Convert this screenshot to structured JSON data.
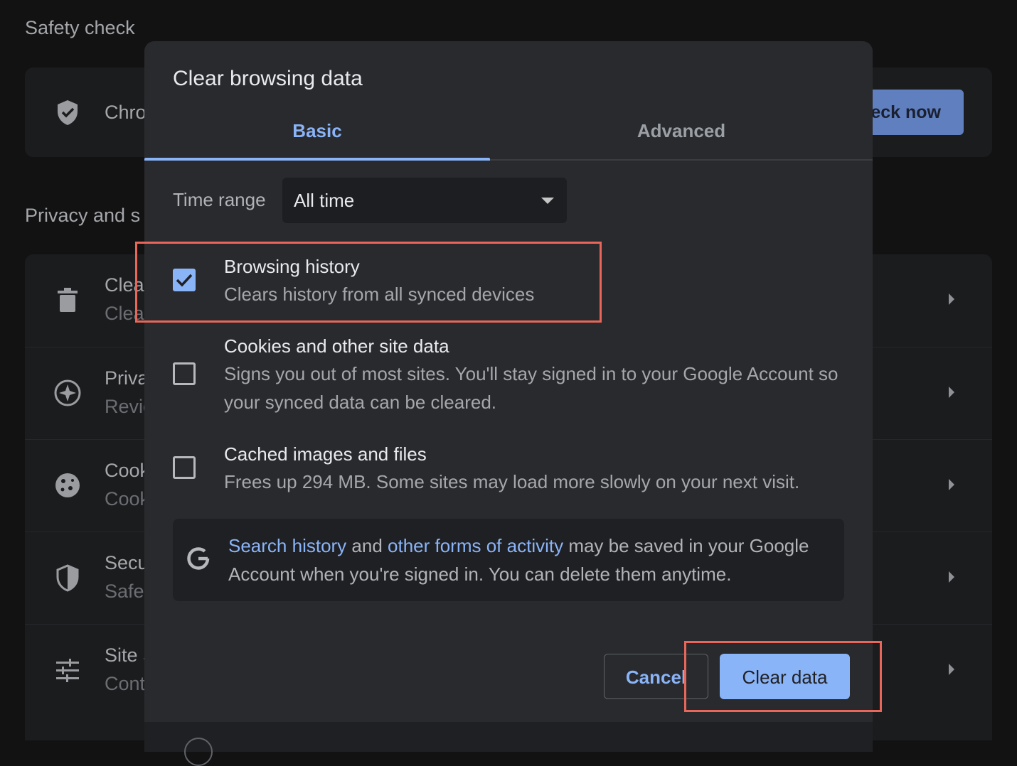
{
  "background": {
    "safety_check": {
      "section_title": "Safety check",
      "row_title": "Chro",
      "button": "eck now"
    },
    "privacy": {
      "section_title": "Privacy and s",
      "rows": [
        {
          "title": "Clea",
          "sub": "Clea"
        },
        {
          "title": "Priva",
          "sub": "Revie"
        },
        {
          "title": "Cook",
          "sub": "Cook"
        },
        {
          "title": "Secu",
          "sub": "Safe"
        },
        {
          "title": "Site S",
          "sub": "Cont"
        }
      ]
    }
  },
  "dialog": {
    "title": "Clear browsing data",
    "tabs": {
      "basic": "Basic",
      "advanced": "Advanced",
      "active": "Basic"
    },
    "time_range": {
      "label": "Time range",
      "value": "All time"
    },
    "options": [
      {
        "title": "Browsing history",
        "description": "Clears history from all synced devices",
        "checked": true
      },
      {
        "title": "Cookies and other site data",
        "description": "Signs you out of most sites. You'll stay signed in to your Google Account so your synced data can be cleared.",
        "checked": false
      },
      {
        "title": "Cached images and files",
        "description": "Frees up 294 MB. Some sites may load more slowly on your next visit.",
        "checked": false
      }
    ],
    "google_notice": {
      "link1": "Search history",
      "and": " and ",
      "link2": "other forms of activity",
      "rest": " may be saved in your Google Account when you're signed in. You can delete them anytime."
    },
    "buttons": {
      "cancel": "Cancel",
      "clear": "Clear data"
    }
  },
  "colors": {
    "accent": "#8ab4f8",
    "highlight": "#e8675a",
    "dialog_bg": "#292a2d",
    "page_bg": "#121213"
  }
}
